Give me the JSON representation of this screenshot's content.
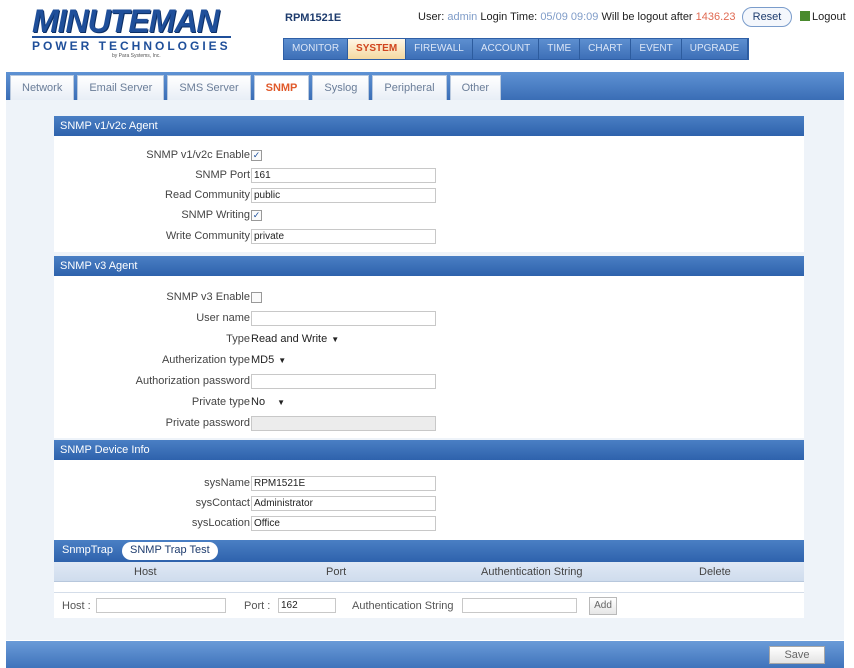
{
  "header": {
    "logo_brand": "MINUTEMAN",
    "logo_sub": "POWER TECHNOLOGIES",
    "logo_tiny": "by Para Systems, Inc.",
    "model": "RPM1521E",
    "user_label": "User:",
    "user_name": "admin",
    "login_label": "Login Time:",
    "login_time": "05/09 09:09",
    "logout_label": "Will be logout after",
    "logout_countdown": "1436.23",
    "reset_label": "Reset",
    "logout_link": "Logout"
  },
  "topnav": [
    "MONITOR",
    "SYSTEM",
    "FIREWALL",
    "ACCOUNT",
    "TIME",
    "CHART",
    "EVENT",
    "UPGRADE"
  ],
  "topnav_active": "SYSTEM",
  "subtabs": [
    "Network",
    "Email Server",
    "SMS Server",
    "SNMP",
    "Syslog",
    "Peripheral",
    "Other"
  ],
  "subtab_active": "SNMP",
  "v1v2": {
    "title": "SNMP v1/v2c Agent",
    "enable_label": "SNMP v1/v2c Enable",
    "enable_checked": "✓",
    "port_label": "SNMP Port",
    "port_value": "161",
    "read_label": "Read Community",
    "read_value": "public",
    "writing_label": "SNMP Writing",
    "writing_checked": "✓",
    "write_label": "Write Community",
    "write_value": "private"
  },
  "v3": {
    "title": "SNMP v3 Agent",
    "enable_label": "SNMP v3 Enable",
    "user_label": "User name",
    "user_value": "",
    "type_label": "Type",
    "type_value": "Read and Write",
    "auth_type_label": "Autherization type",
    "auth_type_value": "MD5",
    "auth_pw_label": "Authorization password",
    "auth_pw_value": "",
    "priv_type_label": "Private type",
    "priv_type_value": "No",
    "priv_pw_label": "Private password",
    "priv_pw_value": ""
  },
  "device": {
    "title": "SNMP Device Info",
    "sysname_label": "sysName",
    "sysname_value": "RPM1521E",
    "syscontact_label": "sysContact",
    "syscontact_value": "Administrator",
    "syslocation_label": "sysLocation",
    "syslocation_value": "Office"
  },
  "trap": {
    "tab1": "SnmpTrap",
    "tab2": "SNMP Trap Test",
    "col_host": "Host",
    "col_port": "Port",
    "col_auth": "Authentication String",
    "col_delete": "Delete",
    "host_label": "Host :",
    "host_value": "",
    "port_label": "Port :",
    "port_value": "162",
    "auth_label": "Authentication String",
    "auth_value": "",
    "add_label": "Add"
  },
  "footer": {
    "save_label": "Save"
  }
}
